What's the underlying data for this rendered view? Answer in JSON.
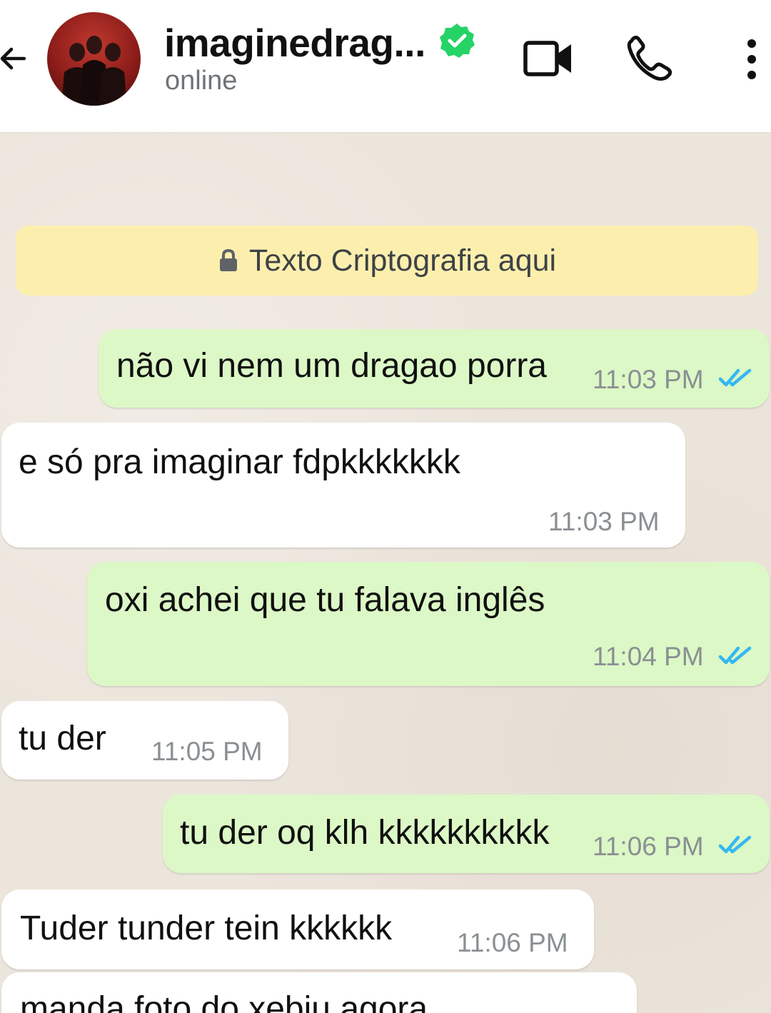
{
  "header": {
    "name": "imaginedrag...",
    "status": "online",
    "icons": {
      "back": "back-arrow-icon",
      "avatar": "avatar",
      "verified": "verified-badge-icon",
      "video": "video-call-icon",
      "phone": "voice-call-icon",
      "menu": "more-options-icon"
    }
  },
  "chat": {
    "encryption_notice": "Texto Criptografia aqui",
    "messages": [
      {
        "direction": "outgoing",
        "text": "não vi nem um dragao porra",
        "time": "11:03 PM",
        "read": true
      },
      {
        "direction": "incoming",
        "text": "e só pra imaginar fdpkkkkkkk",
        "time": "11:03 PM"
      },
      {
        "direction": "outgoing",
        "text": "oxi achei que tu falava inglês",
        "time": "11:04 PM",
        "read": true
      },
      {
        "direction": "incoming",
        "text": "tu der",
        "time": "11:05 PM"
      },
      {
        "direction": "outgoing",
        "text": "tu der oq klh kkkkkkkkkk",
        "time": "11:06 PM",
        "read": true
      },
      {
        "direction": "incoming",
        "text": "Tuder tunder tein kkkkkk",
        "time": "11:06 PM"
      },
      {
        "direction": "incoming",
        "text": "manda foto do xebiu agora",
        "time": ""
      }
    ]
  },
  "colors": {
    "outgoing_bubble": "#dcf8c6",
    "incoming_bubble": "#ffffff",
    "encryption_bg": "#fcefae",
    "read_ticks": "#34b7f1",
    "verified": "#25d366",
    "chat_bg": "#ece5dc"
  }
}
